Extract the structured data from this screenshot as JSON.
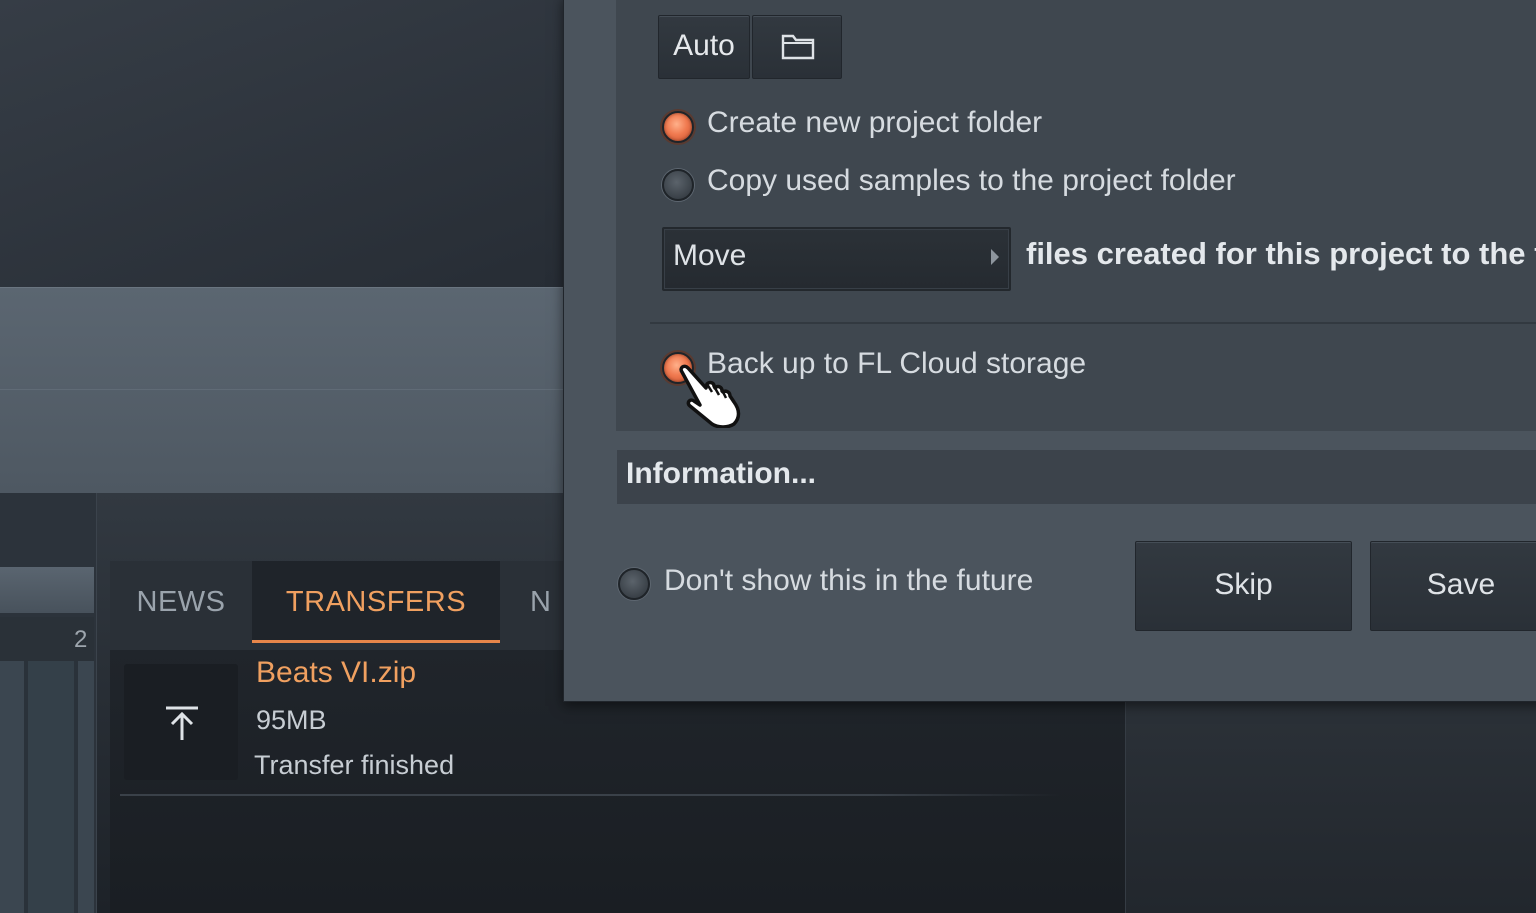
{
  "background": {
    "left_number": "2",
    "tabs": [
      {
        "label": "NEWS",
        "active": false
      },
      {
        "label": "TRANSFERS",
        "active": true
      },
      {
        "label": "N",
        "active": false
      }
    ],
    "transfer": {
      "file_name": "Beats VI.zip",
      "file_size": "95MB",
      "status": "Transfer finished",
      "icon": "upload-icon"
    }
  },
  "dialog": {
    "auto_button": "Auto",
    "folder_button_icon": "folder-icon",
    "options": {
      "create_folder": {
        "label": "Create new project folder",
        "checked": true
      },
      "copy_samples": {
        "label": "Copy used samples to the project folder",
        "checked": false
      }
    },
    "move_select": {
      "value": "Move",
      "description": "files created for this project to the fo"
    },
    "backup": {
      "label": "Back up to FL Cloud storage",
      "checked": true
    },
    "information": "Information...",
    "dont_show": {
      "label": "Don't show this in the future",
      "checked": false
    },
    "buttons": {
      "skip": "Skip",
      "save": "Save"
    }
  },
  "colors": {
    "accent": "#f0a060",
    "radio_on": "#f07a50",
    "panel": "#3f474f",
    "dialog": "#4b545d"
  }
}
